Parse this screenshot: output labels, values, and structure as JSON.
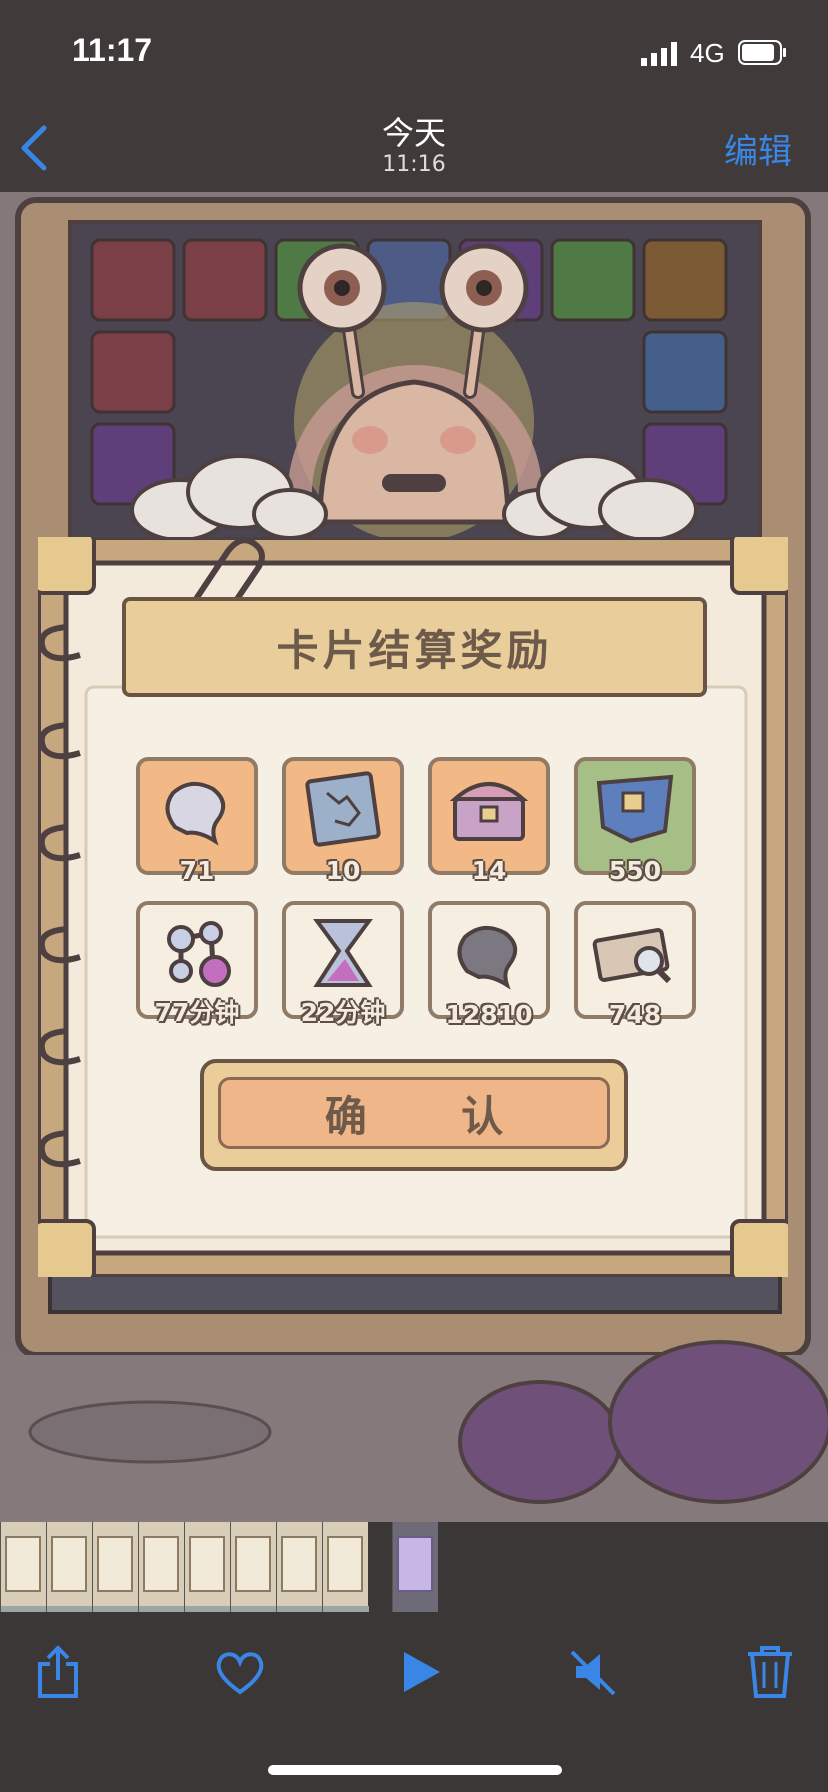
{
  "status_bar": {
    "time": "11:17",
    "network": "4G"
  },
  "nav": {
    "title": "今天",
    "subtitle": "11:16",
    "edit_label": "编辑"
  },
  "game": {
    "header": "卡片结算奖励",
    "confirm_label": "确 认",
    "rewards": [
      {
        "icon": "gray-blob-icon",
        "value": "71",
        "bg": "orange"
      },
      {
        "icon": "map-scroll-icon",
        "value": "10",
        "bg": "orange"
      },
      {
        "icon": "treasure-chest-icon",
        "value": "14",
        "bg": "orange"
      },
      {
        "icon": "blueprint-icon",
        "value": "550",
        "bg": "green"
      },
      {
        "icon": "molecule-potion-icon",
        "value": "77分钟",
        "bg": "cream"
      },
      {
        "icon": "hourglass-icon",
        "value": "22分钟",
        "bg": "cream"
      },
      {
        "icon": "dark-blob-icon",
        "value": "12810",
        "bg": "cream"
      },
      {
        "icon": "ticket-magnifier-icon",
        "value": "748",
        "bg": "cream"
      }
    ]
  },
  "colors": {
    "accent": "#3a86e6",
    "tile_orange": "#f2b886",
    "tile_green": "#a5bf86",
    "tile_cream": "#f6eee0"
  },
  "toolbar": {
    "icons": [
      "share-icon",
      "heart-icon",
      "play-icon",
      "mute-icon",
      "trash-icon"
    ]
  }
}
